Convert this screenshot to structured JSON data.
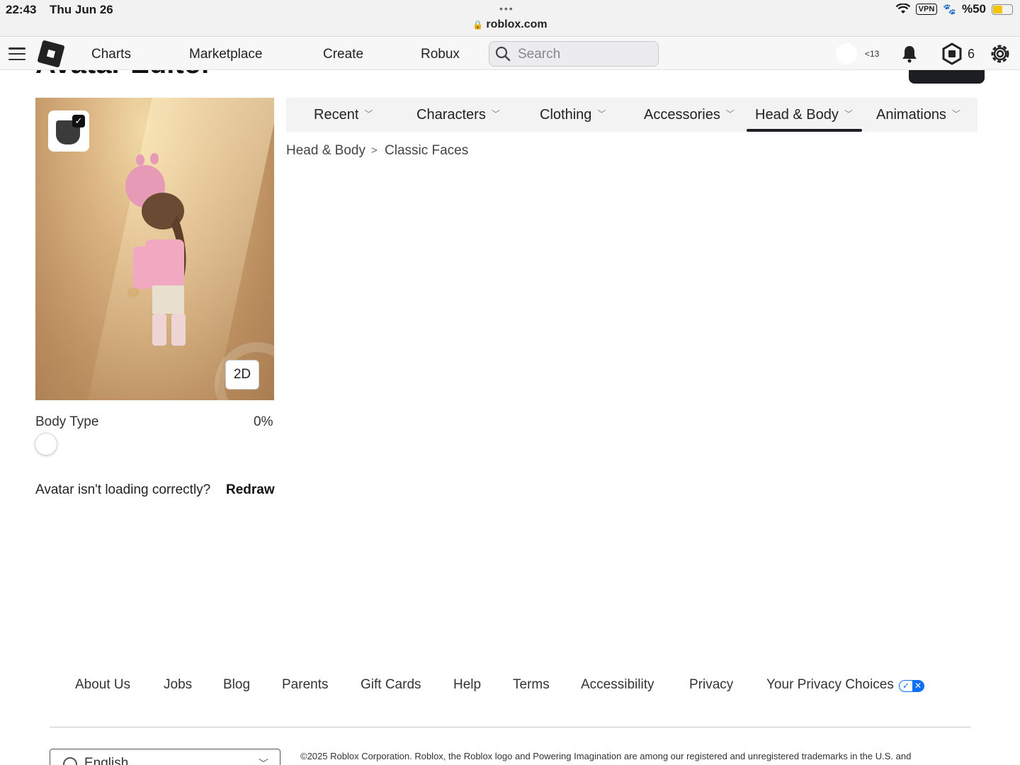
{
  "status_bar": {
    "time": "22:43",
    "date": "Thu Jun 26",
    "dots": "•••",
    "url": "roblox.com",
    "vpn": "VPN",
    "battery": "%50"
  },
  "nav": {
    "links": [
      "Charts",
      "Marketplace",
      "Create",
      "Robux"
    ],
    "search_placeholder": "Search",
    "age_label": "<13",
    "robux_count": "6"
  },
  "page": {
    "title": "Avatar Editor"
  },
  "preview": {
    "toggle_label": "2D",
    "body_type_label": "Body Type",
    "body_type_value": "0%",
    "body_type_fraction": 0,
    "redraw_question": "Avatar isn't loading correctly?",
    "redraw_link": "Redraw"
  },
  "tabs": {
    "items": [
      "Recent",
      "Characters",
      "Clothing",
      "Accessories",
      "Head & Body",
      "Animations"
    ],
    "active": "Head & Body"
  },
  "breadcrumb": {
    "parent": "Head & Body",
    "separator": ">",
    "current": "Classic Faces"
  },
  "footer": {
    "links": [
      "About Us",
      "Jobs",
      "Blog",
      "Parents",
      "Gift Cards",
      "Help",
      "Terms",
      "Accessibility",
      "Privacy",
      "Your Privacy Choices"
    ],
    "language": "English",
    "copyright": "©2025 Roblox Corporation. Roblox, the Roblox logo and Powering Imagination are among our registered and unregistered trademarks in the U.S. and"
  },
  "colors": {
    "accent_dark": "#1d1e22",
    "privacy_blue": "#0d6ef6",
    "battery_yellow": "#f5c400"
  },
  "icons": [
    "hamburger-icon",
    "roblox-logo-icon",
    "search-icon",
    "bell-icon",
    "robux-icon",
    "gear-icon",
    "lock-icon",
    "wifi-icon",
    "battery-icon",
    "chevron-down-icon",
    "globe-icon"
  ]
}
